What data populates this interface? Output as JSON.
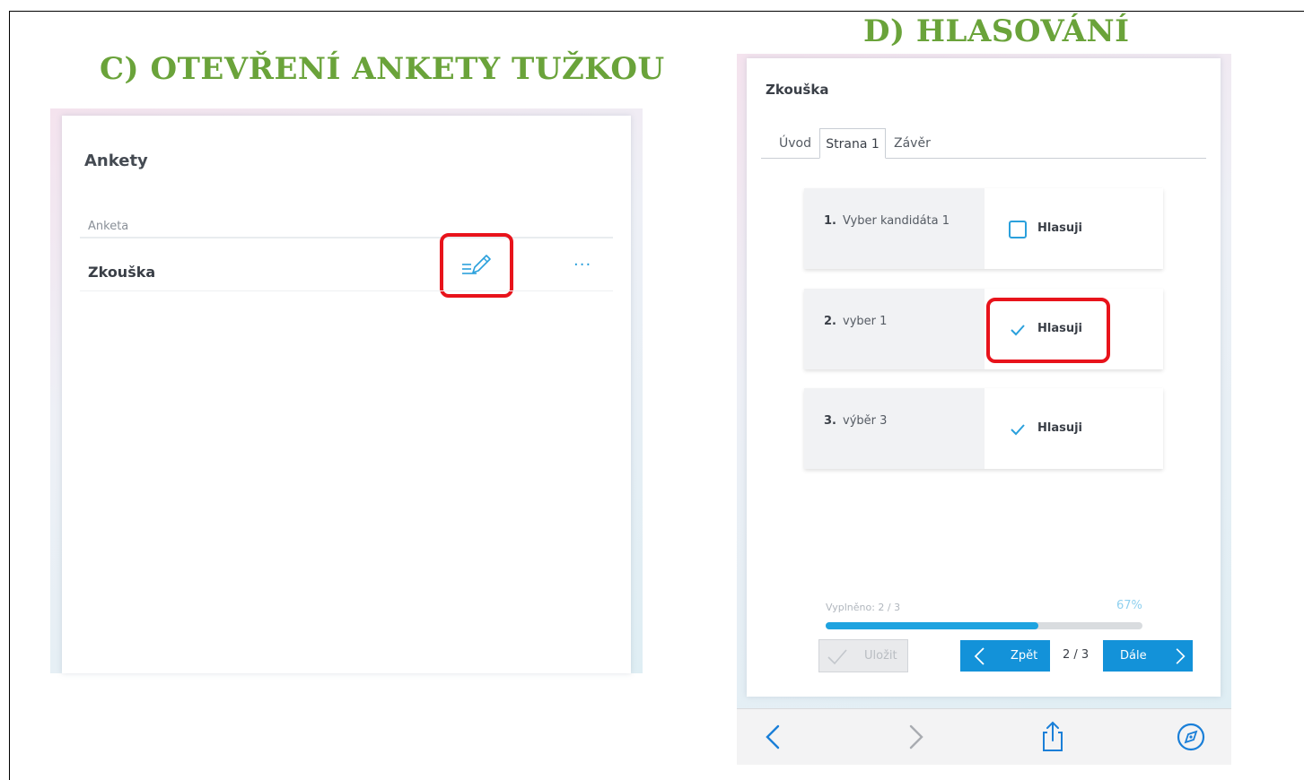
{
  "headings": {
    "left": "C) OTEVŘENÍ ANKETY TUŽKOU",
    "right": "D) HLASOVÁNÍ"
  },
  "polls_list": {
    "title": "Ankety",
    "column_header": "Anketa",
    "rows": [
      {
        "name": "Zkouška",
        "edit_icon": "pencil-edit-icon",
        "more": "···"
      }
    ]
  },
  "poll": {
    "title": "Zkouška",
    "tabs": [
      {
        "label": "Úvod",
        "active": false
      },
      {
        "label": "Strana 1",
        "active": true
      },
      {
        "label": "Závěr",
        "active": false
      }
    ],
    "questions": [
      {
        "num": "1.",
        "text": "Vyber kandidáta 1",
        "vote_label": "Hlasuji",
        "checked": false
      },
      {
        "num": "2.",
        "text": "vyber 1",
        "vote_label": "Hlasuji",
        "checked": true
      },
      {
        "num": "3.",
        "text": "výběr 3",
        "vote_label": "Hlasuji",
        "checked": true
      }
    ],
    "progress": {
      "label": "Vyplněno: 2 / 3",
      "percent_text": "67%",
      "fraction": 0.67
    },
    "buttons": {
      "save": "Uložit",
      "back": "Zpět",
      "next": "Dále",
      "page_indicator": "2 / 3"
    }
  },
  "browser_toolbar": {
    "icons": [
      "back-arrow-icon",
      "forward-arrow-icon",
      "share-icon",
      "compass-icon"
    ]
  },
  "colors": {
    "heading_green": "#6aa33a",
    "accent_blue": "#1392d9",
    "highlight_red": "#e8131b"
  }
}
